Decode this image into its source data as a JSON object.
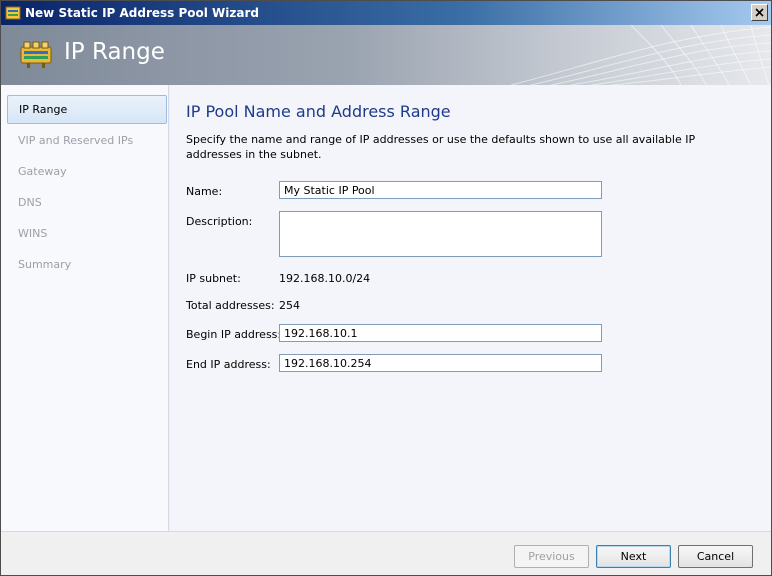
{
  "window": {
    "title": "New Static IP Address Pool Wizard",
    "close_label": "X"
  },
  "banner": {
    "title": "IP Range"
  },
  "nav": {
    "items": [
      {
        "label": "IP Range",
        "active": true
      },
      {
        "label": "VIP and Reserved IPs",
        "active": false
      },
      {
        "label": "Gateway",
        "active": false
      },
      {
        "label": "DNS",
        "active": false
      },
      {
        "label": "WINS",
        "active": false
      },
      {
        "label": "Summary",
        "active": false
      }
    ]
  },
  "main": {
    "title": "IP Pool Name and Address Range",
    "description": "Specify the name and range of IP addresses or use the defaults shown to use all available IP addresses in the subnet.",
    "name_label": "Name:",
    "name_value": "My Static IP Pool",
    "description_label": "Description:",
    "description_value": "",
    "subnet_label": "IP subnet:",
    "subnet_value": "192.168.10.0/24",
    "total_label": "Total addresses:",
    "total_value": "254",
    "begin_label": "Begin IP address:",
    "begin_value": "192.168.10.1",
    "end_label": "End IP address:",
    "end_value": "192.168.10.254"
  },
  "footer": {
    "previous_label": "Previous",
    "next_label": "Next",
    "cancel_label": "Cancel"
  },
  "colors": {
    "title_bar": "#0a246a",
    "section_title": "#1e3a8a",
    "nav_active_border": "#9fbbe0"
  }
}
